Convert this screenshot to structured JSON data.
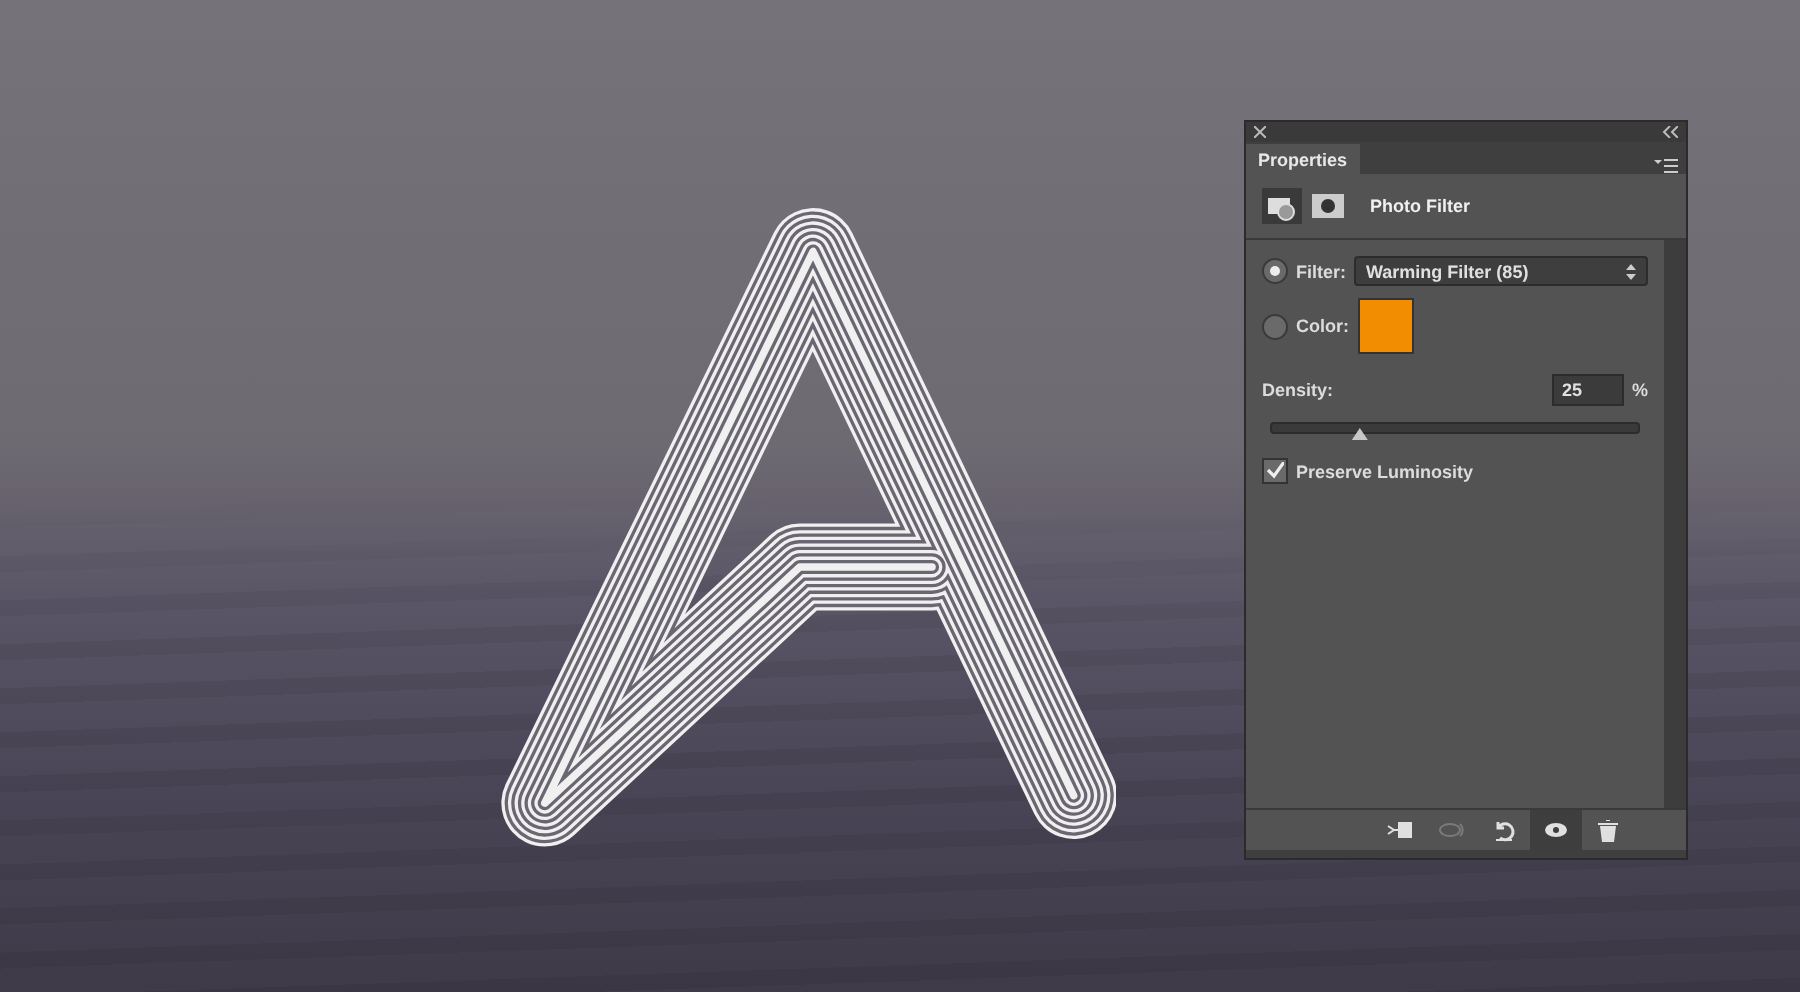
{
  "panel": {
    "title": "Properties",
    "adjustment": "Photo Filter",
    "options": [
      {
        "kind": "select",
        "label": "Filter:",
        "selected": true,
        "value": "Warming Filter (85)"
      },
      {
        "kind": "swatch",
        "label": "Color:",
        "selected": false,
        "color": "#f28c00"
      }
    ],
    "density": {
      "label": "Density:",
      "value": "25",
      "unit": "%",
      "level": 0.24
    },
    "preserve": {
      "label": "Preserve Luminosity",
      "checked": true
    },
    "toolbar": [
      {
        "kind": "clip",
        "disabled": false,
        "selected": false
      },
      {
        "kind": "previous",
        "disabled": true,
        "selected": false
      },
      {
        "kind": "reset",
        "disabled": false,
        "selected": false
      },
      {
        "kind": "visibility",
        "disabled": false,
        "selected": true
      },
      {
        "kind": "delete",
        "disabled": false,
        "selected": false
      }
    ]
  }
}
